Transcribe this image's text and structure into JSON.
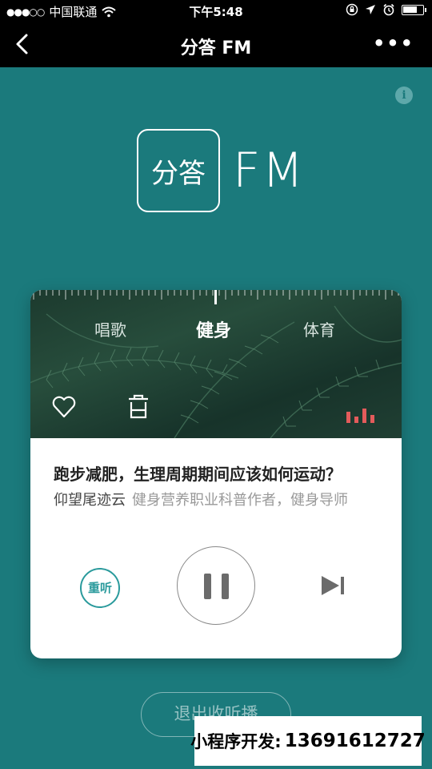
{
  "status_bar": {
    "signal": "●●●○○",
    "carrier": "中国联通",
    "time": "下午5:48",
    "battery_level": 0.75
  },
  "nav": {
    "title": "分答 FM",
    "more": "•••"
  },
  "info_icon": "i",
  "logo": {
    "mark_text": "分答",
    "fm_text": "FM"
  },
  "categories": [
    "唱歌",
    "健身",
    "体育"
  ],
  "active_category": "健身",
  "track": {
    "title": "跑步减肥，生理周期期间应该如何运动？",
    "author": "仰望尾迹云",
    "author_desc": "健身营养职业科普作者，健身导师"
  },
  "controls": {
    "replay_label": "重听"
  },
  "exit_label": "退出收听播",
  "promo": {
    "label": "小程序开发:",
    "phone": "13691612727"
  },
  "colors": {
    "background": "#1b7a7c",
    "accent": "#2a9a9c",
    "bars": "#e35b5b"
  }
}
